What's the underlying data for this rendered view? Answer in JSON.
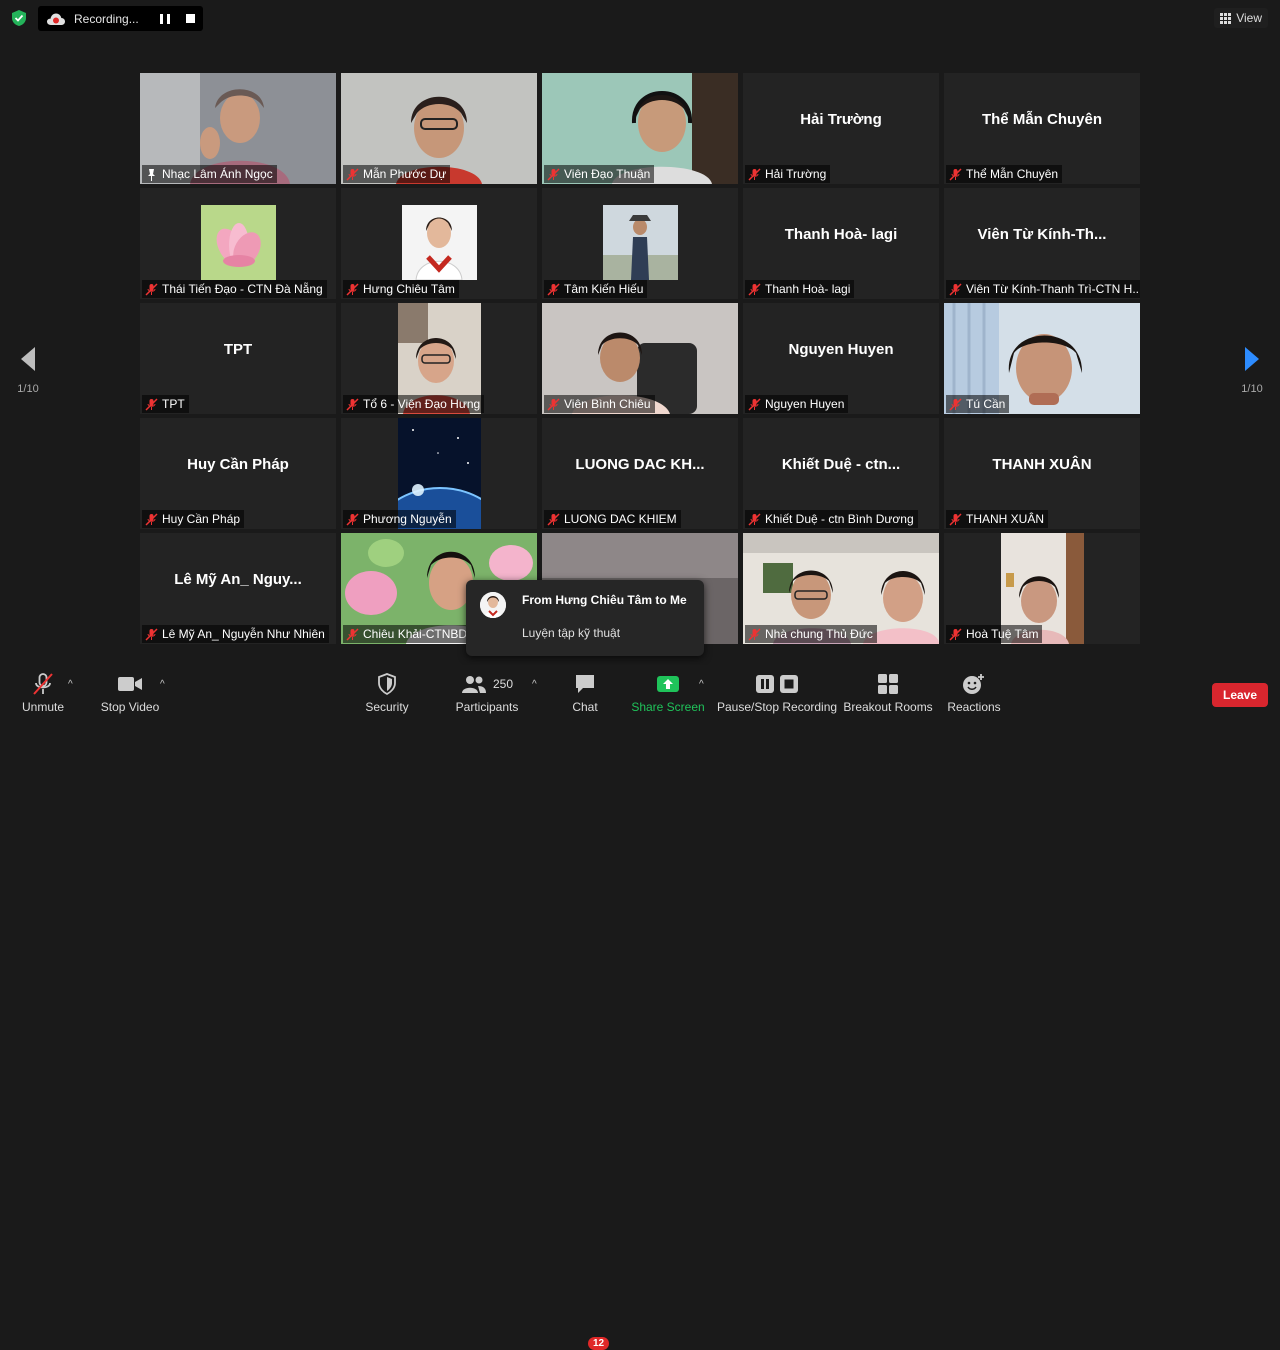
{
  "top_bar": {
    "recording_label": "Recording...",
    "view_label": "View"
  },
  "pagination": {
    "left_page": "1/10",
    "right_page": "1/10"
  },
  "participants": [
    {
      "display": "",
      "label": "Nhạc Lâm Ánh Ngọc",
      "active_speaker": true,
      "pinned": true
    },
    {
      "display": "",
      "label": "Mẫn Phước Dự"
    },
    {
      "display": "",
      "label": "Viên Đạo Thuận"
    },
    {
      "display": "Hải Trường",
      "label": "Hải Trường"
    },
    {
      "display": "Thể Mẫn Chuyên",
      "label": "Thể Mẫn Chuyên"
    },
    {
      "display": "",
      "label": "Thái Tiến Đạo - CTN Đà Nẵng"
    },
    {
      "display": "",
      "label": "Hưng Chiêu Tâm"
    },
    {
      "display": "",
      "label": "Tâm Kiến Hiếu"
    },
    {
      "display": "Thanh Hoà- lagi",
      "label": "Thanh Hoà- lagi"
    },
    {
      "display": "Viên Từ Kính-Th...",
      "label": "Viên Từ Kính-Thanh Trì-CTN H..."
    },
    {
      "display": "TPT",
      "label": "TPT"
    },
    {
      "display": "",
      "label": "Tổ 6  - Viện Đạo Hưng"
    },
    {
      "display": "",
      "label": "Viên Bình Chiêu"
    },
    {
      "display": "Nguyen Huyen",
      "label": "Nguyen Huyen"
    },
    {
      "display": "",
      "label": "Tú Cần"
    },
    {
      "display": "Huy Cần Pháp",
      "label": "Huy Cần Pháp"
    },
    {
      "display": "",
      "label": "Phương Nguyễn"
    },
    {
      "display": "LUONG DAC KH...",
      "label": "LUONG DAC KHIEM"
    },
    {
      "display": "Khiết Duệ - ctn...",
      "label": "Khiết Duệ - ctn Bình Dương"
    },
    {
      "display": "THANH XUÂN",
      "label": "THANH XUÂN"
    },
    {
      "display": "Lê Mỹ An_ Nguy...",
      "label": "Lê Mỹ An_ Nguyễn Như Nhiên"
    },
    {
      "display": "",
      "label": "Chiêu Khải-CTNBD"
    },
    {
      "display": "",
      "label": ""
    },
    {
      "display": "",
      "label": "Nhà chung Thủ Đức"
    },
    {
      "display": "",
      "label": "Hoà Tuệ Tâm"
    }
  ],
  "chat_notification": {
    "title": "From Hưng Chiêu Tâm to Me",
    "message": "Luyện tập kỹ thuật"
  },
  "toolbar": {
    "unmute": "Unmute",
    "stop_video": "Stop Video",
    "security": "Security",
    "participants": "Participants",
    "participant_count": "250",
    "chat": "Chat",
    "chat_badge": "12",
    "share_screen": "Share Screen",
    "recording": "Pause/Stop Recording",
    "breakout": "Breakout Rooms",
    "reactions": "Reactions",
    "leave": "Leave"
  },
  "colors": {
    "active_speaker_border": "#b7e24f",
    "share_green": "#1fc35a",
    "leave_red": "#d9262e",
    "badge_red": "#e02828",
    "nav_arrow_blue": "#2d8cff"
  }
}
